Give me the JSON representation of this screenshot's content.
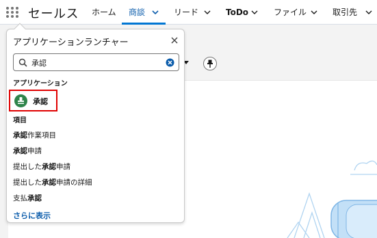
{
  "nav": {
    "app_name": "セールス",
    "tabs": [
      {
        "label": "ホーム",
        "has_menu": false,
        "active": false
      },
      {
        "label": "商談",
        "has_menu": true,
        "active": true
      },
      {
        "label": "リード",
        "has_menu": true,
        "active": false
      },
      {
        "label": "ToDo",
        "has_menu": true,
        "active": false
      },
      {
        "label": "ファイル",
        "has_menu": true,
        "active": false
      },
      {
        "label": "取引先",
        "has_menu": true,
        "active": false
      }
    ]
  },
  "launcher": {
    "title": "アプリケーションランチャー",
    "search_value": "承認",
    "apps_heading": "アプリケーション",
    "app_label": "承認",
    "items_heading": "項目",
    "items": [
      {
        "bold": "承認",
        "rest": "作業項目",
        "prefix": ""
      },
      {
        "bold": "承認",
        "rest": "申請",
        "prefix": ""
      },
      {
        "prefix": "提出した",
        "bold": "承認",
        "rest": "申請"
      },
      {
        "prefix": "提出した",
        "bold": "承認",
        "rest": "申請の詳細"
      },
      {
        "prefix": "支払",
        "bold": "承認",
        "rest": ""
      }
    ],
    "show_more": "さらに表示"
  },
  "colors": {
    "accent": "#0176d3",
    "active_text": "#0b5cab",
    "app_icon": "#2e844a",
    "highlight_border": "#e00000"
  },
  "icons": {
    "launcher": "waffle-icon",
    "close": "close-icon",
    "search": "search-icon",
    "clear": "clear-icon",
    "pin": "pin-icon"
  }
}
